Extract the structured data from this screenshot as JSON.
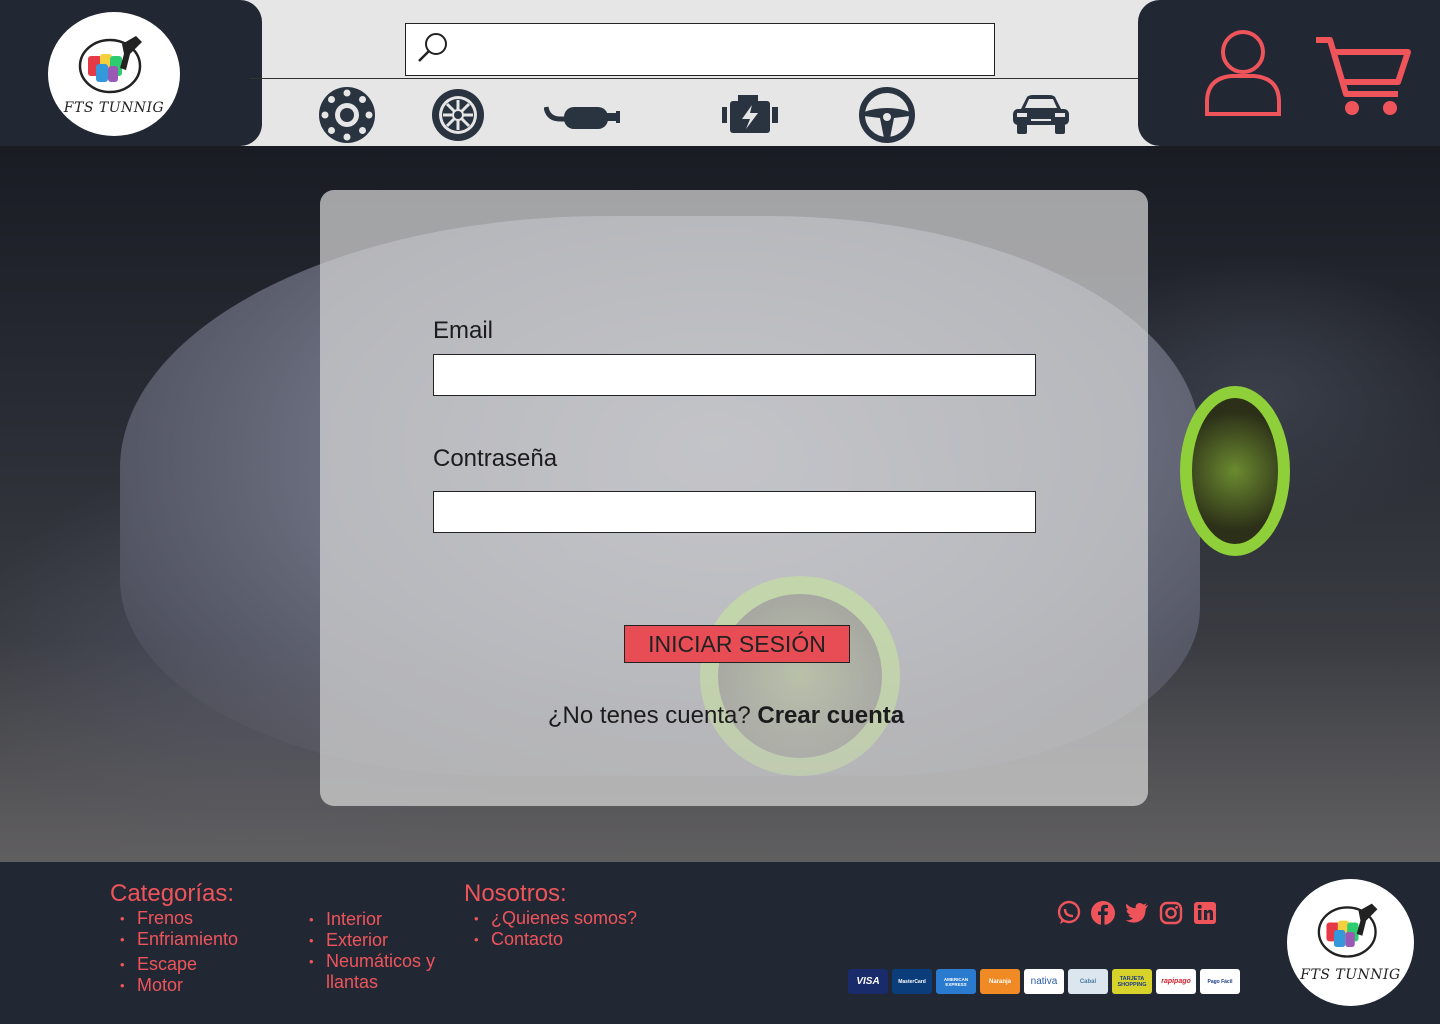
{
  "brand": {
    "name": "FTS TUNNIG"
  },
  "search": {
    "placeholder": "",
    "value": ""
  },
  "categories_nav": [
    {
      "name": "frenos",
      "icon": "brake-disc-icon"
    },
    {
      "name": "llantas",
      "icon": "wheel-icon"
    },
    {
      "name": "escape",
      "icon": "exhaust-icon"
    },
    {
      "name": "motor",
      "icon": "engine-icon"
    },
    {
      "name": "interior",
      "icon": "steering-wheel-icon"
    },
    {
      "name": "exterior",
      "icon": "car-icon"
    }
  ],
  "login": {
    "email_label": "Email",
    "email_value": "",
    "password_label": "Contraseña",
    "password_value": "",
    "submit_label": "INICIAR SESIÓN",
    "signup_prompt": "¿No tenes cuenta?",
    "signup_link": "Crear cuenta"
  },
  "footer": {
    "categories_title": "Categorías:",
    "categories_col1": [
      "Frenos",
      "Enfriamiento",
      "Escape",
      "Motor"
    ],
    "categories_col2": [
      "Interior",
      "Exterior",
      "Neumáticos y llantas"
    ],
    "about_title": "Nosotros:",
    "about_items": [
      "¿Quienes somos?",
      "Contacto"
    ],
    "social": [
      "whatsapp-icon",
      "facebook-icon",
      "twitter-icon",
      "instagram-icon",
      "linkedin-icon"
    ],
    "payments": [
      "VISA",
      "MasterCard",
      "AMERICAN EXPRESS",
      "Naranja",
      "nativa",
      "Cabal",
      "TARJETA SHOPPING",
      "rapipago",
      "Pago Fácil"
    ]
  },
  "colors": {
    "accent": "#ef545b",
    "dark": "#222833",
    "header_bg": "#e6e6e6",
    "button": "#e84d55"
  }
}
